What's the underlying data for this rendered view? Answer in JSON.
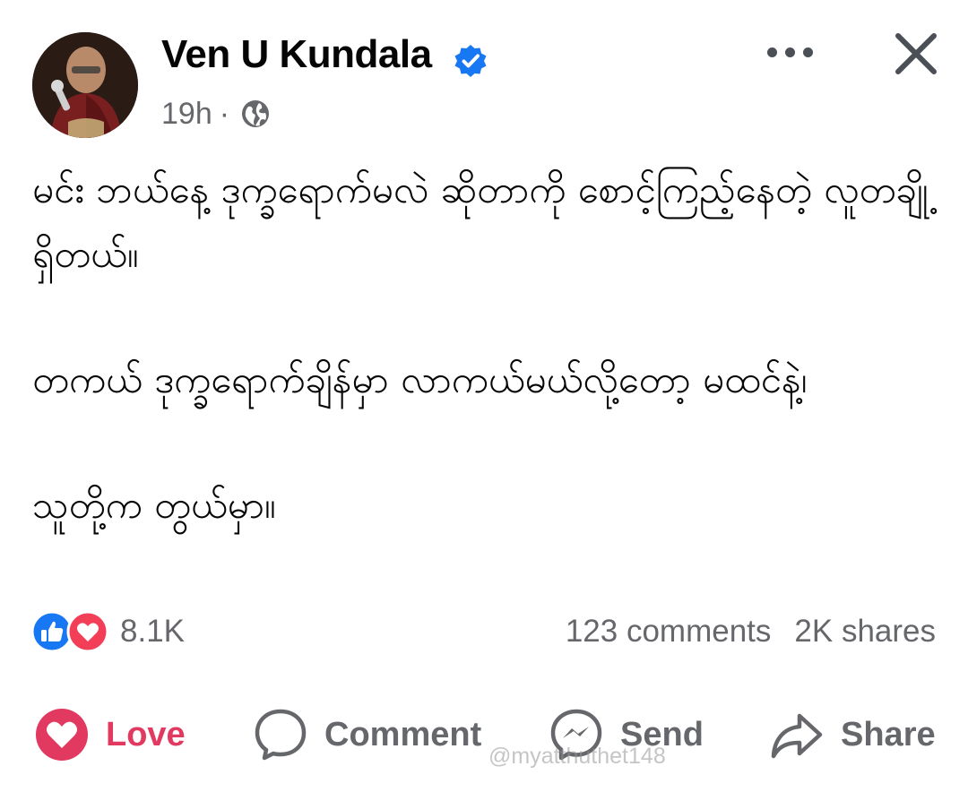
{
  "post": {
    "author": "Ven U Kundala",
    "time": "19h",
    "separator": "·",
    "paragraphs": [
      "မင်း ဘယ်နေ့ ဒုက္ခရောက်မလဲ ဆိုတာကို စောင့်ကြည့်နေတဲ့ လူတချို့ရှိတယ်။",
      "တကယ် ဒုက္ခရောက်ချိန်မှာ လာကယ်မယ်လို့တော့ မထင်နဲ့၊",
      "သူတို့က တွယ်မှာ။"
    ]
  },
  "engagement": {
    "reaction_count": "8.1K",
    "comments": "123 comments",
    "shares": "2K shares"
  },
  "actions": {
    "love": "Love",
    "comment": "Comment",
    "send": "Send",
    "share": "Share"
  },
  "watermark": "@myatthuthet148",
  "colors": {
    "love": "#e1395f",
    "like_blue": "#1877f2",
    "verified_blue": "#1877f2",
    "secondary_text": "#65676b"
  },
  "icons": [
    "verified-badge-icon",
    "globe-icon",
    "more-options-icon",
    "close-icon",
    "like-reaction-icon",
    "love-reaction-icon",
    "heart-icon",
    "comment-icon",
    "messenger-icon",
    "share-icon"
  ]
}
